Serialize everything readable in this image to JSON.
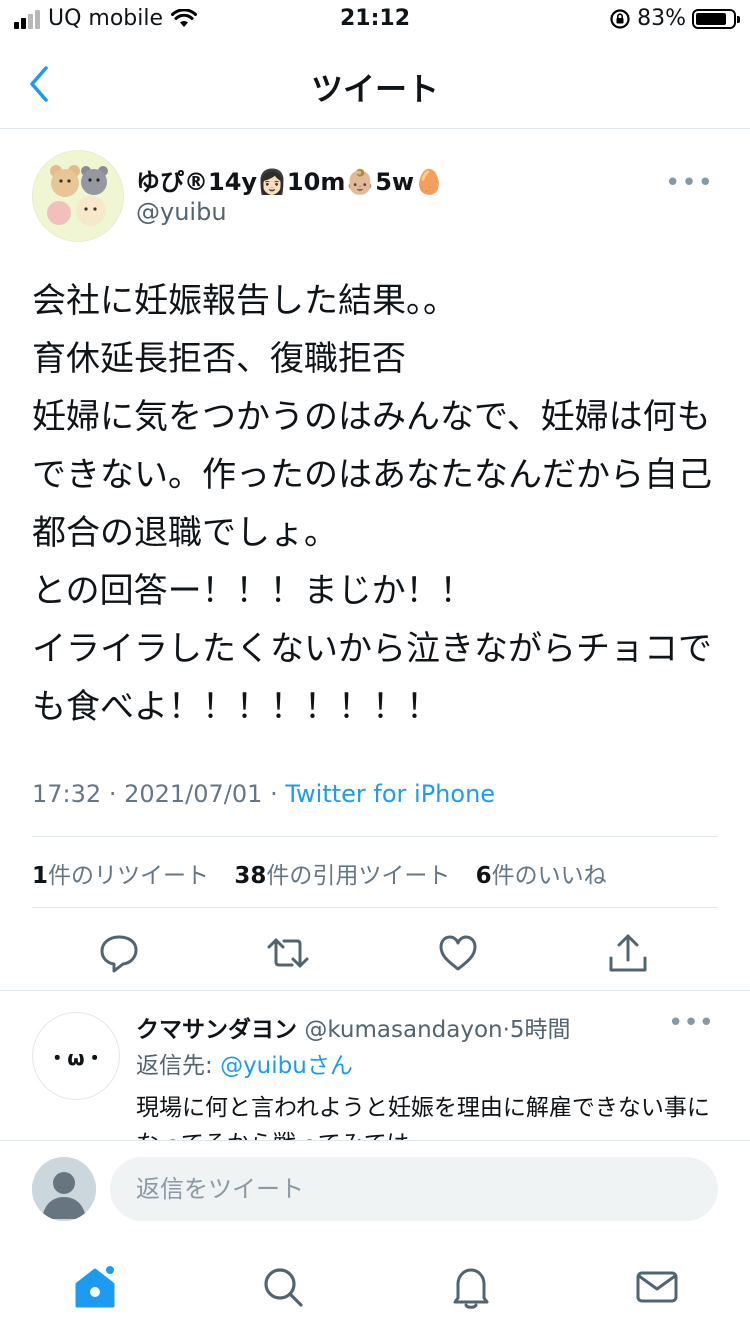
{
  "status_bar": {
    "carrier": "UQ mobile",
    "time": "21:12",
    "battery_percent": "83%",
    "battery_level": 0.83
  },
  "nav": {
    "back_icon": "chevron-left-icon",
    "title": "ツイート"
  },
  "tweet": {
    "author_name": "ゆぴ®14y👩🏻10m👶🏼5w🥚",
    "author_handle": "@yuibu",
    "text": "会社に妊娠報告した結果。。\n育休延長拒否、復職拒否\n妊婦に気をつかうのはみんなで、妊婦は何もできない。作ったのはあなたなんだから自己都合の退職でしょ。\nとの回答ー！！！まじか！！\nイライラしたくないから泣きながらチョコでも食べよ！！！！！！！！",
    "time": "17:32",
    "date": "2021/07/01",
    "meta_separator": "·",
    "source": "Twitter for iPhone",
    "more_label": "•••"
  },
  "stats": {
    "retweets_count": "1",
    "retweets_label": "件のリツイート",
    "quotes_count": "38",
    "quotes_label": "件の引用ツイート",
    "likes_count": "6",
    "likes_label": "件のいいね"
  },
  "actions": [
    "reply-icon",
    "retweet-icon",
    "like-icon",
    "share-icon"
  ],
  "reply": {
    "avatar_text": "・ω・",
    "name": "クマサンダヨン",
    "handle": "@kumasandayon",
    "separator": "·",
    "time_ago": "5時間",
    "reply_to_label": "返信先: ",
    "reply_to_user": "@yuibuさん",
    "text": "現場に何と言われようと妊娠を理由に解雇できない事になってるから戦ってみては",
    "more_label": "•••"
  },
  "composer": {
    "placeholder": "返信をツイート"
  },
  "tab_bar": {
    "items": [
      "home-icon",
      "search-icon",
      "notifications-icon",
      "messages-icon"
    ]
  },
  "colors": {
    "accent": "#1d9bf0",
    "secondary_text": "#657786",
    "divider": "#e1e8ed"
  }
}
